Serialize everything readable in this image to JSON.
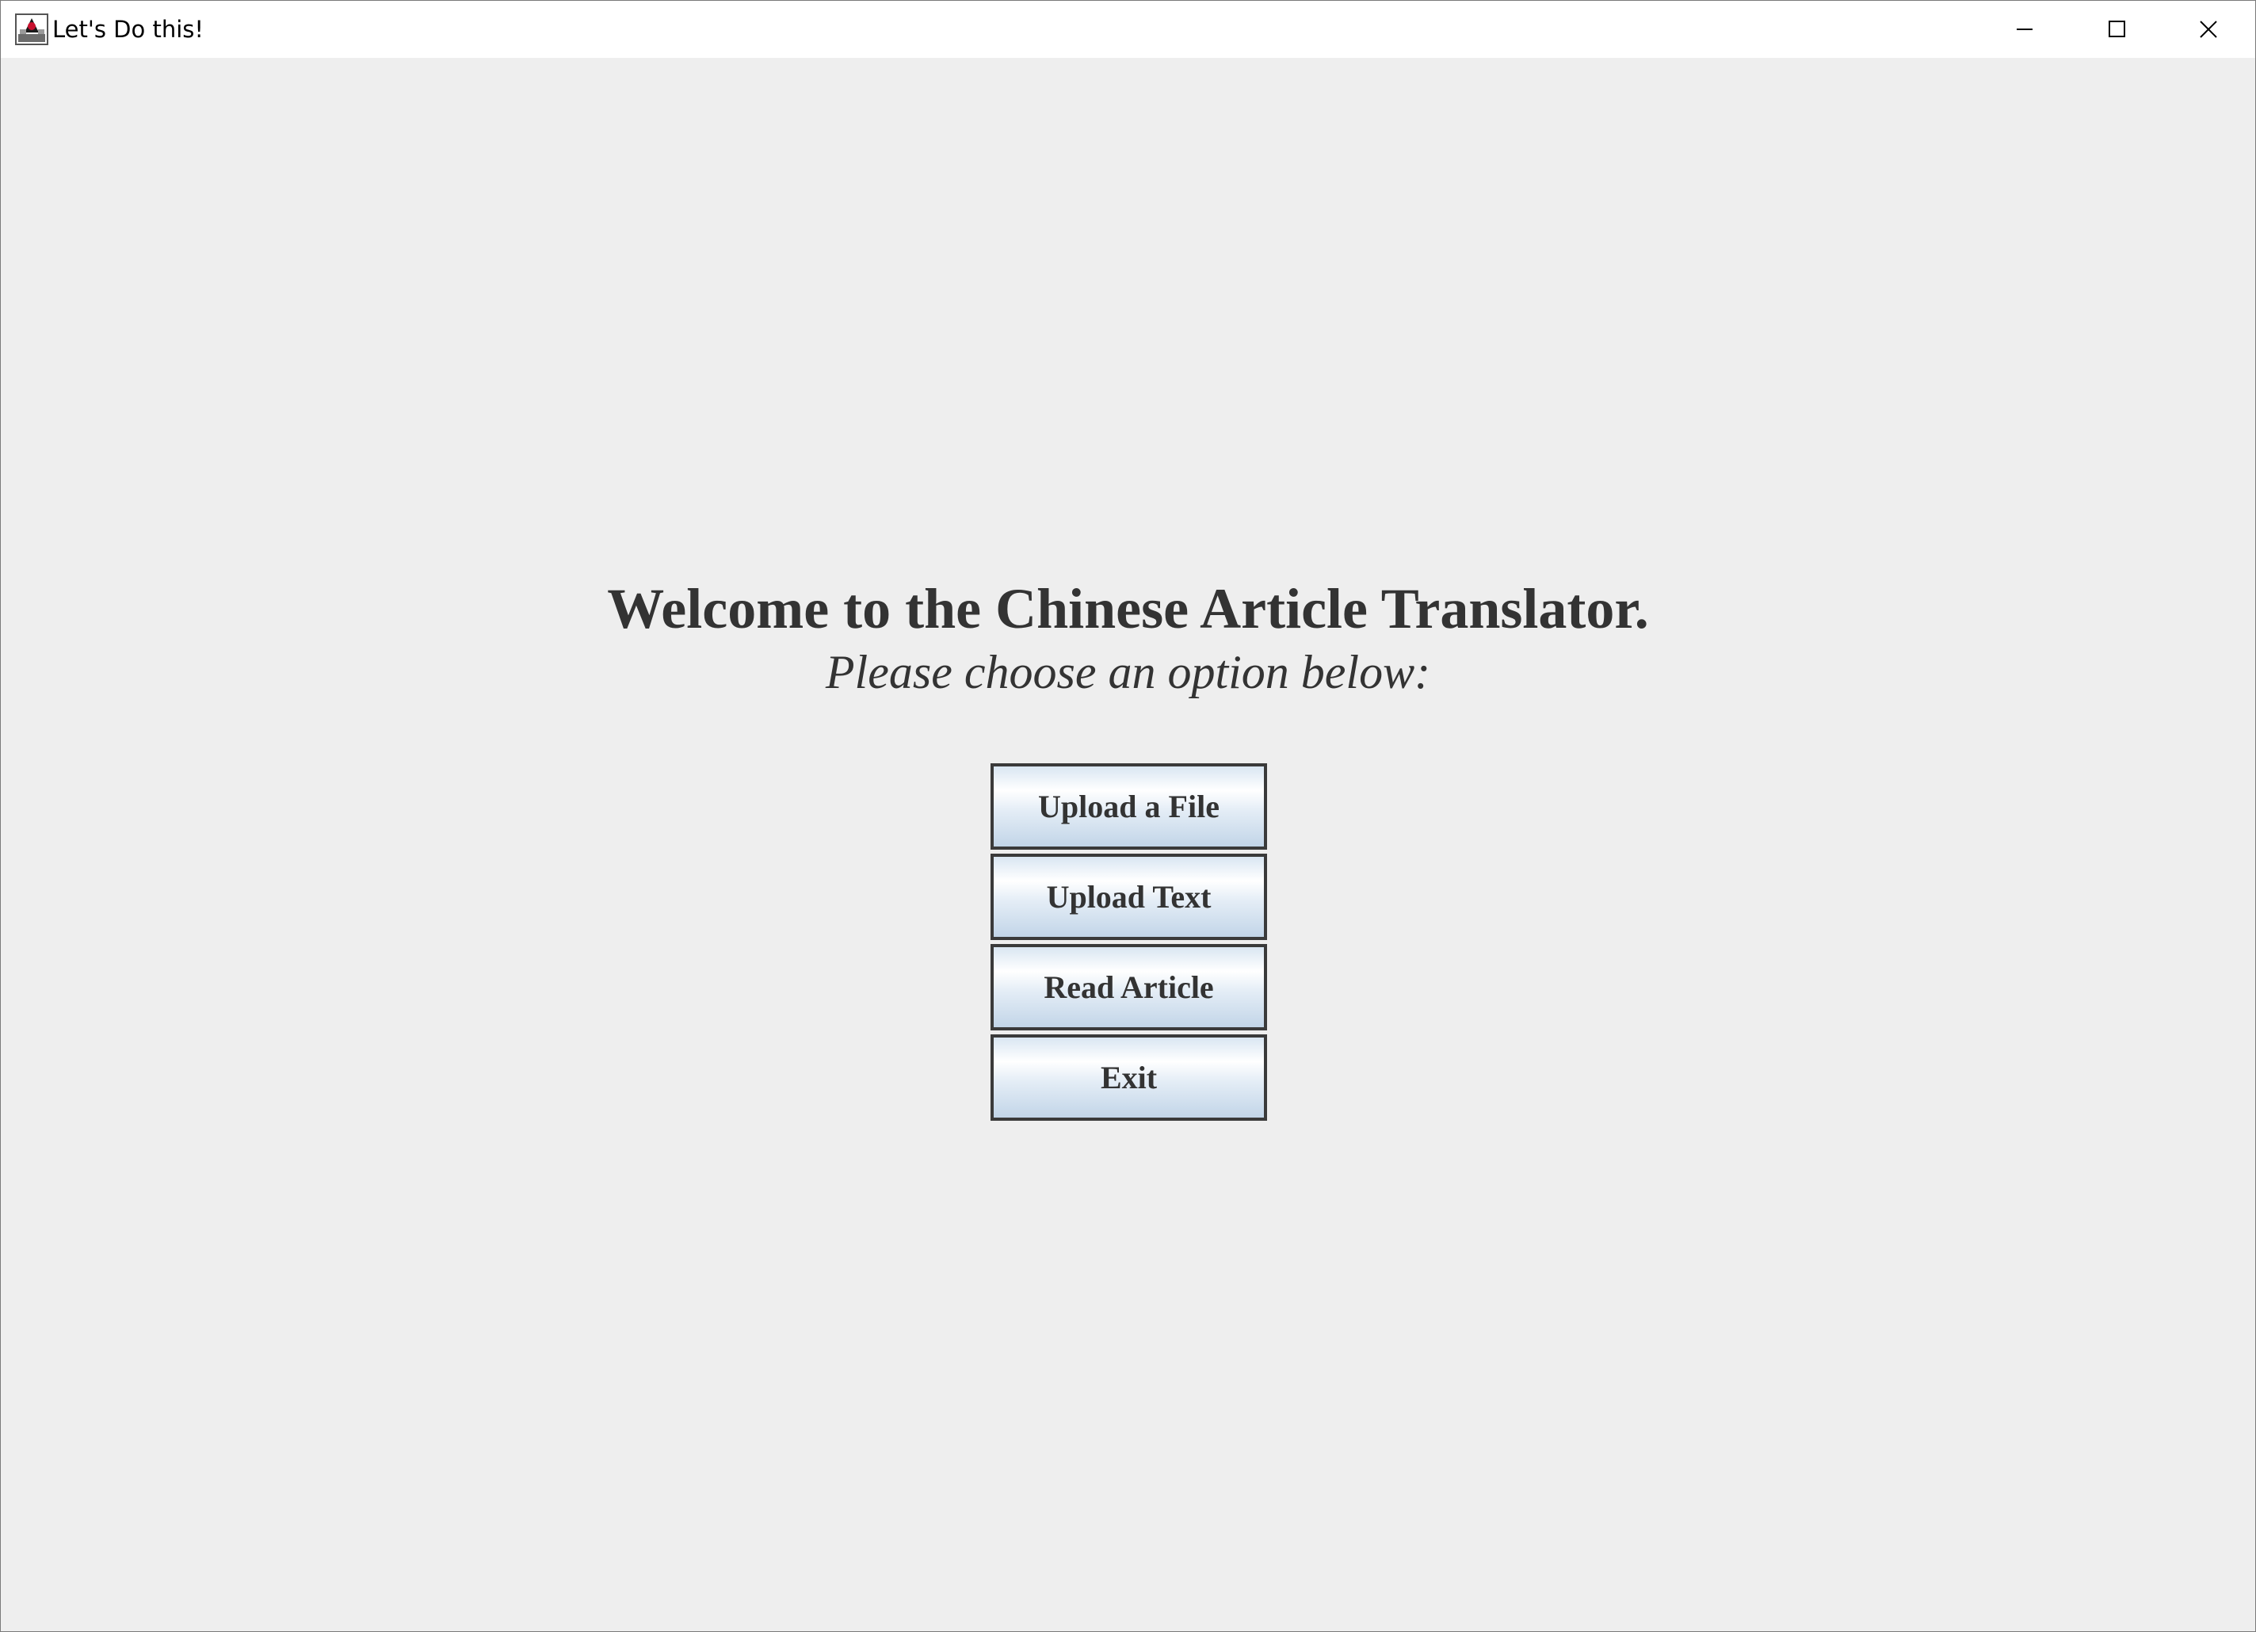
{
  "window": {
    "title": "Let's Do this!",
    "app_icon": "java-duke-icon",
    "controls": {
      "minimize_icon": "minimize-icon",
      "maximize_icon": "maximize-icon",
      "close_icon": "close-icon"
    }
  },
  "main": {
    "heading": "Welcome to the Chinese Article Translator.",
    "subheading": "Please choose an option below:",
    "buttons": [
      {
        "label": "Upload a File"
      },
      {
        "label": "Upload Text"
      },
      {
        "label": "Read Article"
      },
      {
        "label": "Exit"
      }
    ]
  },
  "colors": {
    "background": "#eeeeee",
    "text": "#333333",
    "button_border": "#3a3a3a",
    "button_gradient_top": "#ffffff",
    "button_gradient_bottom": "#c2d5e8"
  }
}
